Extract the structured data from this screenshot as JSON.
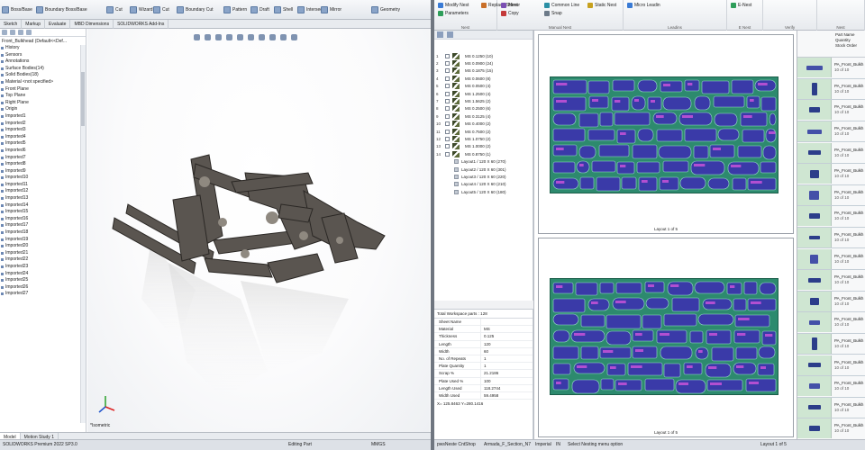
{
  "solidworks": {
    "ribbon": {
      "items": [
        {
          "label": "Boss/Base",
          "icon": "extrude-icon"
        },
        {
          "label": "Boundary Boss/Base",
          "icon": "boundary-icon"
        },
        {
          "label": "Cut",
          "icon": "cut-icon"
        },
        {
          "label": "Wizard",
          "icon": "hole-wizard-icon"
        },
        {
          "label": "Cut",
          "icon": "revolve-cut-icon"
        },
        {
          "label": "Boundary Cut",
          "icon": "boundary-cut-icon"
        },
        {
          "label": "Pattern",
          "icon": "pattern-icon"
        },
        {
          "label": "Draft",
          "icon": "draft-icon"
        },
        {
          "label": "Shell",
          "icon": "shell-icon"
        },
        {
          "label": "Intersect",
          "icon": "intersect-icon"
        },
        {
          "label": "Mirror",
          "icon": "mirror-icon"
        },
        {
          "label": "Geometry",
          "icon": "ref-geometry-icon"
        }
      ]
    },
    "tabs": [
      "Sketch",
      "Markup",
      "Evaluate",
      "MBD Dimensions",
      "SOLIDWORKS Add-Ins"
    ],
    "tree": {
      "root": "Front_Bulkhead (Default<<Def...",
      "items": [
        "History",
        "Sensors",
        "Annotations",
        "Surface Bodies(14)",
        "Solid Bodies(18)",
        "Material <not specified>",
        "Front Plane",
        "Top Plane",
        "Right Plane",
        "Origin",
        "Imported1",
        "Imported2",
        "Imported3",
        "Imported4",
        "Imported5",
        "Imported6",
        "Imported7",
        "Imported8",
        "Imported9",
        "Imported10",
        "Imported11",
        "Imported12",
        "Imported13",
        "Imported14",
        "Imported15",
        "Imported16",
        "Imported17",
        "Imported18",
        "Imported19",
        "Imported20",
        "Imported21",
        "Imported22",
        "Imported23",
        "Imported24",
        "Imported25",
        "Imported26",
        "Imported27"
      ]
    },
    "viewport": {
      "view_label": "*Isometric"
    },
    "bottom_tabs": [
      "Model",
      "Motion Study 1"
    ],
    "status": {
      "product": "SOLIDWORKS Premium 2022 SP3.0",
      "mode": "Editing Part",
      "units": "MMGS"
    }
  },
  "nesting": {
    "ribbon": {
      "groups": [
        {
          "label": "Nest",
          "buttons": [
            "Modify Nest",
            "Parameters",
            "Replace Sheet"
          ]
        },
        {
          "label": "Manual Nest",
          "buttons": [
            "Mirror",
            "Copy",
            "Common Line",
            "Snap",
            "Static Nest"
          ]
        },
        {
          "label": "Leadins",
          "buttons": [
            "Micro Leadin"
          ]
        },
        {
          "label": "E Nest",
          "buttons": [
            "E-Nest"
          ]
        },
        {
          "label": "Verify",
          "buttons": []
        },
        {
          "label": "Nest",
          "buttons": []
        }
      ]
    },
    "parts_tree": [
      {
        "num": "1",
        "label": "MS 0.1250 (10)"
      },
      {
        "num": "2",
        "label": "MS 0.0900 (24)"
      },
      {
        "num": "3",
        "label": "MS 0.1875 (15)"
      },
      {
        "num": "4",
        "label": "MS 0.0600 (8)"
      },
      {
        "num": "5",
        "label": "MS 0.0500 (4)"
      },
      {
        "num": "6",
        "label": "MS 1.2500 (4)"
      },
      {
        "num": "7",
        "label": "MS 1.5625 (2)"
      },
      {
        "num": "8",
        "label": "MS 0.2500 (6)"
      },
      {
        "num": "9",
        "label": "MS 0.3125 (4)"
      },
      {
        "num": "10",
        "label": "MS 0.4000 (2)"
      },
      {
        "num": "11",
        "label": "MS 0.7500 (2)"
      },
      {
        "num": "12",
        "label": "MS 1.0750 (2)"
      },
      {
        "num": "13",
        "label": "MS 1.0000 (2)"
      },
      {
        "num": "14",
        "label": "MS 0.8750 (1)"
      }
    ],
    "layouts": [
      "Layout1 / 120 X 60 (270)",
      "Layout2 / 120 X 60 (301)",
      "Layout3 / 120 X 60 (220)",
      "Layout4 / 120 X 60 (210)",
      "Layout5 / 120 X 60 (180)"
    ],
    "props": {
      "title": "Total Workspace parts : 128",
      "rows": [
        {
          "k": "Sheet Name",
          "v": ""
        },
        {
          "k": "Material",
          "v": "MS"
        },
        {
          "k": "Thickness",
          "v": "0.125"
        },
        {
          "k": "Length",
          "v": "120"
        },
        {
          "k": "Width",
          "v": "60"
        },
        {
          "k": "No. of Repeats",
          "v": "1"
        },
        {
          "k": "Plate Quantity",
          "v": "1"
        },
        {
          "k": "Scrap %",
          "v": "21.2186"
        },
        {
          "k": "Plate Used %",
          "v": "100"
        },
        {
          "k": "Length Used",
          "v": "118.2744"
        },
        {
          "k": "Width Used",
          "v": "59.4958"
        }
      ],
      "footer": "X= 125.8463 Y=280.1416"
    },
    "sheets": [
      {
        "label": "Layout 1 of 5"
      },
      {
        "label": "Layout 1 of 5"
      }
    ],
    "parts_list": {
      "header": [
        "Part Name",
        "Quantity",
        "Stock Order"
      ],
      "items": [
        {
          "name": "PA_Front_Bulkh",
          "qty": "10 of 10"
        },
        {
          "name": "PA_Front_Bulkh",
          "qty": "10 of 10"
        },
        {
          "name": "PA_Front_Bulkh",
          "qty": "10 of 10"
        },
        {
          "name": "PA_Front_Bulkh",
          "qty": "10 of 10"
        },
        {
          "name": "PA_Front_Bulkh",
          "qty": "10 of 10"
        },
        {
          "name": "PA_Front_Bulkh",
          "qty": "10 of 10"
        },
        {
          "name": "PA_Front_Bulkh",
          "qty": "10 of 10"
        },
        {
          "name": "PA_Front_Bulkh",
          "qty": "10 of 10"
        },
        {
          "name": "PA_Front_Bulkh",
          "qty": "10 of 10"
        },
        {
          "name": "PA_Front_Bulkh",
          "qty": "10 of 10"
        },
        {
          "name": "PA_Front_Bulkh",
          "qty": "10 of 10"
        },
        {
          "name": "PA_Front_Bulkh",
          "qty": "10 of 10"
        },
        {
          "name": "PA_Front_Bulkh",
          "qty": "10 of 10"
        },
        {
          "name": "PA_Front_Bulkh",
          "qty": "10 of 10"
        },
        {
          "name": "PA_Front_Bulkh",
          "qty": "10 of 10"
        },
        {
          "name": "PA_Front_Bulkh",
          "qty": "10 of 10"
        },
        {
          "name": "PA_Front_Bulkh",
          "qty": "10 of 10"
        },
        {
          "name": "PA_Front_Bulkh",
          "qty": "10 of 10"
        }
      ]
    },
    "status": {
      "left": "pwsNeste CntShop",
      "doc": "Armada_F_Section_N7",
      "units": "Imperial",
      "in": "IN",
      "hint": "Select Nesting menu option",
      "page": "Layout 1 of 5"
    }
  },
  "colors": {
    "plate": "#2d8a6e",
    "part": "#3a3aa8",
    "parts_thumb": "#cfe6d2"
  }
}
